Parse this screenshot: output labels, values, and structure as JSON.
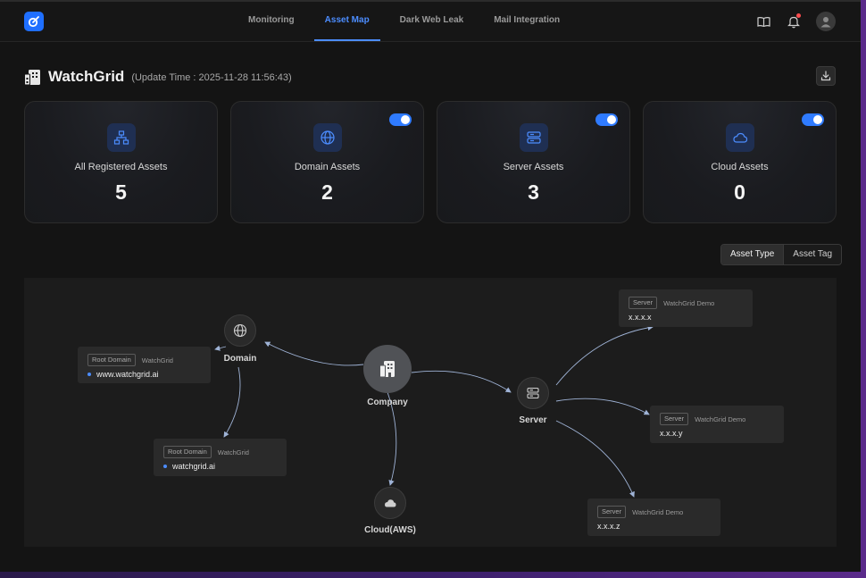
{
  "nav": {
    "items": [
      {
        "label": "Monitoring",
        "active": false
      },
      {
        "label": "Asset Map",
        "active": true
      },
      {
        "label": "Dark Web Leak",
        "active": false
      },
      {
        "label": "Mail Integration",
        "active": false
      }
    ]
  },
  "header": {
    "title": "WatchGrid",
    "update_time": "(Update Time : 2025-11-28 11:56:43)"
  },
  "cards": [
    {
      "label": "All Registered Assets",
      "value": "5",
      "icon": "sitemap-icon",
      "toggle": false
    },
    {
      "label": "Domain Assets",
      "value": "2",
      "icon": "globe-icon",
      "toggle": true
    },
    {
      "label": "Server Assets",
      "value": "3",
      "icon": "server-icon",
      "toggle": true
    },
    {
      "label": "Cloud Assets",
      "value": "0",
      "icon": "cloud-icon",
      "toggle": true
    }
  ],
  "view_toggle": {
    "asset_type": "Asset Type",
    "asset_tag": "Asset Tag",
    "active": "Asset Type"
  },
  "map": {
    "nodes": {
      "company": "Company",
      "domain": "Domain",
      "server": "Server",
      "cloud": "Cloud(AWS)"
    },
    "domain_assets": [
      {
        "tag": "Root Domain",
        "owner": "WatchGrid",
        "value": "www.watchgrid.ai"
      },
      {
        "tag": "Root Domain",
        "owner": "WatchGrid",
        "value": "watchgrid.ai"
      }
    ],
    "server_assets": [
      {
        "tag": "Server",
        "owner": "WatchGrid Demo",
        "value": "x.x.x.x"
      },
      {
        "tag": "Server",
        "owner": "WatchGrid Demo",
        "value": "x.x.x.y"
      },
      {
        "tag": "Server",
        "owner": "WatchGrid Demo",
        "value": "x.x.x.z"
      }
    ]
  },
  "colors": {
    "accent": "#4c8dff",
    "background": "#141414",
    "card_icon_bg": "#1f2f52",
    "toggle_on": "#2f7bff"
  }
}
